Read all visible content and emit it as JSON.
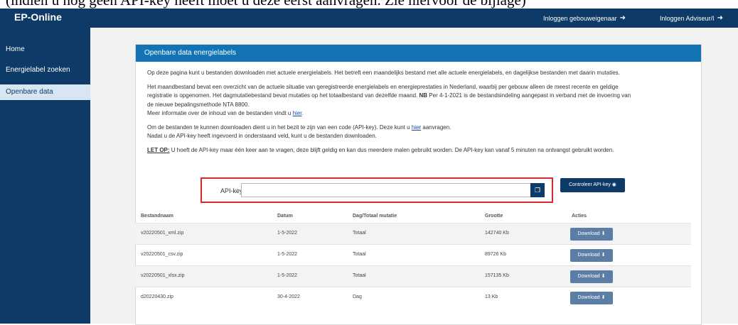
{
  "doc_banner": "(indien u nog geen API-key heeft moet u deze eerst aanvragen. Zie hiervoor de bijlage)",
  "header": {
    "brand": "EP-Online",
    "login_owner": "Inloggen gebouweigenaar",
    "login_advisor": "Inloggen Adviseur/I"
  },
  "sidebar": {
    "items": [
      {
        "label": "Home"
      },
      {
        "label": "Energielabel zoeken"
      },
      {
        "label": "Openbare data",
        "active": true
      }
    ]
  },
  "panel": {
    "title": "Openbare data energielabels",
    "p1": "Op deze pagina kunt u bestanden downloaden met actuele energielabels. Het betreft een maandelijks bestand met alle actuele energielabels, en dagelijkse bestanden met daarin mutaties.",
    "p2_line1": "Het maandbestand bevat een overzicht van de actuele situatie van geregistreerde energielabels en energieprestaties in Nederland, waarbij per gebouw alleen de meest recente en geldige",
    "p2_line2_start": "registratie is opgenomen. Het dagmutatiebestand bevat mutaties op het totaalbestand van dezelfde maand.",
    "p2_nb": "NB",
    "p2_line2_end": "Per 4-1-2021 is de bestandsindeling aangepast in verband met de invoering van",
    "p2_line3": "de nieuwe bepalingsmethode NTA 8800.",
    "p2_line4_start": "Meer informatie over de inhoud van de bestanden vindt u",
    "p2_link": "hier",
    "p2_line4_end": ".",
    "p3_line1_start": "Om de bestanden te kunnen downloaden dient u in het bezit te zijn van een code (API-key). Deze kunt u",
    "p3_link": "hier",
    "p3_line1_end": "aanvragen.",
    "p3_line2": "Nadat u de API-key heeft ingevoerd in onderstaand veld, kunt u de bestanden downloaden.",
    "letop_label": "LET OP:",
    "letop_text": "U hoeft de API-key maar één keer aan te vragen, deze blijft geldig en kan dus meerdere malen gebruikt worden. De API-key kan vanaf 5 minuten na ontvangst gebruikt worden.",
    "api_label": "API-key",
    "api_value": "",
    "check_button": "Controleer API-key"
  },
  "table": {
    "headers": [
      "Bestandnaam",
      "Datum",
      "Dag/Totaal mutatie",
      "Grootte",
      "Acties"
    ],
    "rows": [
      {
        "name": "v20220501_xml.zip",
        "date": "1-5-2022",
        "type": "Totaal",
        "size": "142740 Kb",
        "action": "Download"
      },
      {
        "name": "v20220501_csv.zip",
        "date": "1-5-2022",
        "type": "Totaal",
        "size": "89726 Kb",
        "action": "Download"
      },
      {
        "name": "v20220501_xlsx.zip",
        "date": "1-5-2022",
        "type": "Totaal",
        "size": "157135 Kb",
        "action": "Download"
      },
      {
        "name": "d20220430.zip",
        "date": "30-4-2022",
        "type": "Dag",
        "size": "13 Kb",
        "action": "Download"
      }
    ]
  },
  "colors": {
    "navy": "#0d3a66",
    "panel_header": "#1274b5",
    "highlight_box": "#d62a2a",
    "download_button": "#5b7ea6"
  },
  "icons": {
    "login": "sign-in-icon",
    "copy": "paste-icon",
    "eye": "eye-icon",
    "download": "download-icon"
  }
}
